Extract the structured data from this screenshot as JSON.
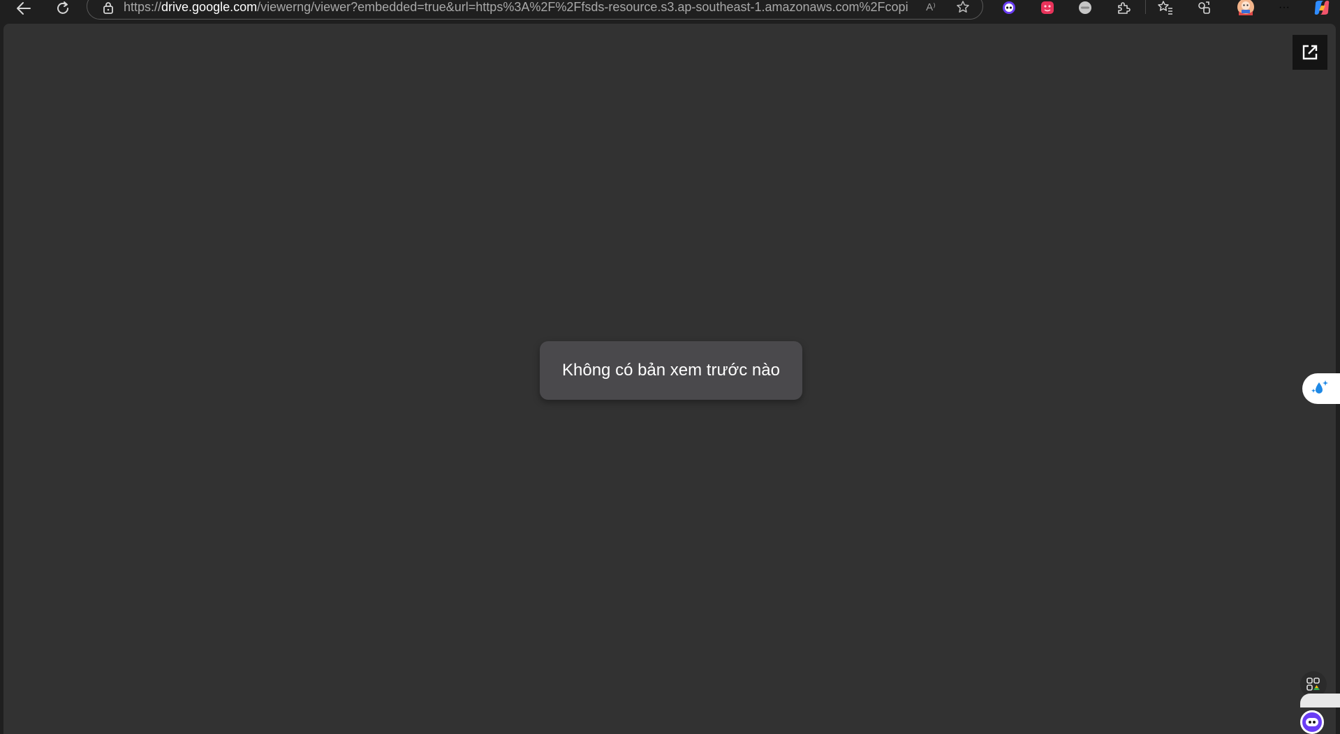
{
  "browser": {
    "url": {
      "scheme": "https://",
      "host": "drive.google.com",
      "rest": "/viewerng/viewer?embedded=true&url=https%3A%2F%2Ffsds-resource.s3.ap-southeast-1.amazonaws.com%2Fcopie..."
    },
    "read_aloud_label": "A⁾",
    "icons": {
      "back": "back-arrow-icon",
      "refresh": "refresh-icon",
      "lock": "lock-icon",
      "favorite": "star-icon",
      "extensions": "puzzle-icon",
      "favorites": "favorites-icon",
      "profile": "avatar",
      "more": "more-icon",
      "copilot": "copilot-icon"
    },
    "more_label": "···"
  },
  "viewer": {
    "message": "Không có bản xem trước nào",
    "background": "#323232",
    "message_background": "#4a494c"
  }
}
